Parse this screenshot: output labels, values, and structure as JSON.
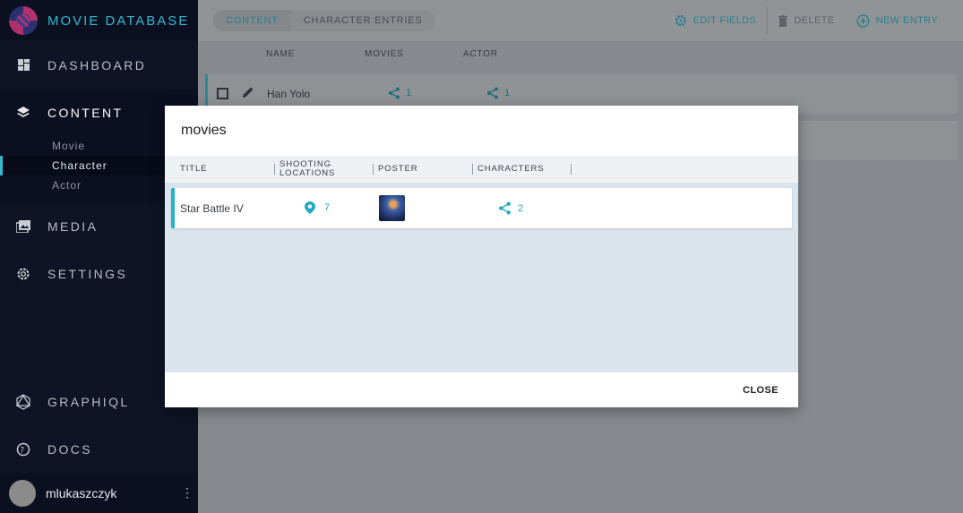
{
  "app": {
    "title": "MOVIE DATABASE"
  },
  "sidebar": {
    "items": [
      {
        "label": "DASHBOARD",
        "icon": "dashboard-icon"
      },
      {
        "label": "CONTENT",
        "icon": "layers-icon"
      },
      {
        "label": "MEDIA",
        "icon": "media-icon"
      },
      {
        "label": "SETTINGS",
        "icon": "gear-icon"
      }
    ],
    "content_sub": [
      "Movie",
      "Character",
      "Actor"
    ],
    "bottom_items": [
      {
        "label": "GRAPHIQL",
        "icon": "graphql-icon"
      },
      {
        "label": "DOCS",
        "icon": "help-icon"
      }
    ],
    "user": {
      "name": "mlukaszczyk"
    }
  },
  "topbar": {
    "breadcrumb": [
      "CONTENT",
      "CHARACTER ENTRIES"
    ],
    "edit_label": "EDIT FIELDS",
    "delete_label": "DELETE",
    "new_label": "NEW ENTRY"
  },
  "table": {
    "columns": [
      "NAME",
      "MOVIES",
      "ACTOR"
    ],
    "rows": [
      {
        "name": "Han Yolo",
        "movies": "1",
        "actor": "1"
      }
    ]
  },
  "modal": {
    "title": "movies",
    "columns": [
      "TITLE",
      "SHOOTING LOCATIONS",
      "POSTER",
      "CHARACTERS"
    ],
    "row": {
      "title": "Star Battle IV",
      "locations": "7",
      "characters": "2"
    },
    "close_label": "CLOSE"
  },
  "colors": {
    "accent": "#20b4cc",
    "sidebar_bg": "#0e1425"
  }
}
